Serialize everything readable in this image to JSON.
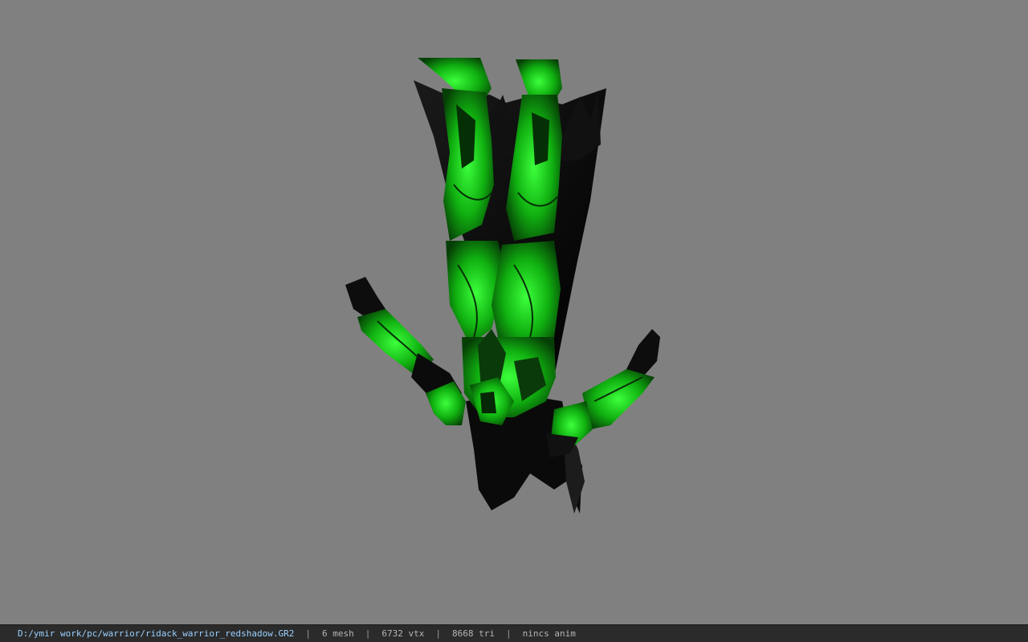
{
  "viewport": {
    "background": "#808080",
    "model_icon": "inverted-armored-warrior-model",
    "armor_color": "#1fd81f",
    "body_color": "#0a0a0a"
  },
  "statusbar": {
    "file_path": "D:/ymir work/pc/warrior/ridack_warrior_redshadow.GR2",
    "separator": "|",
    "mesh_count": "6 mesh",
    "vertex_count": "6732 vtx",
    "triangle_count": "8668 tri",
    "anim_status": "nincs anim"
  }
}
